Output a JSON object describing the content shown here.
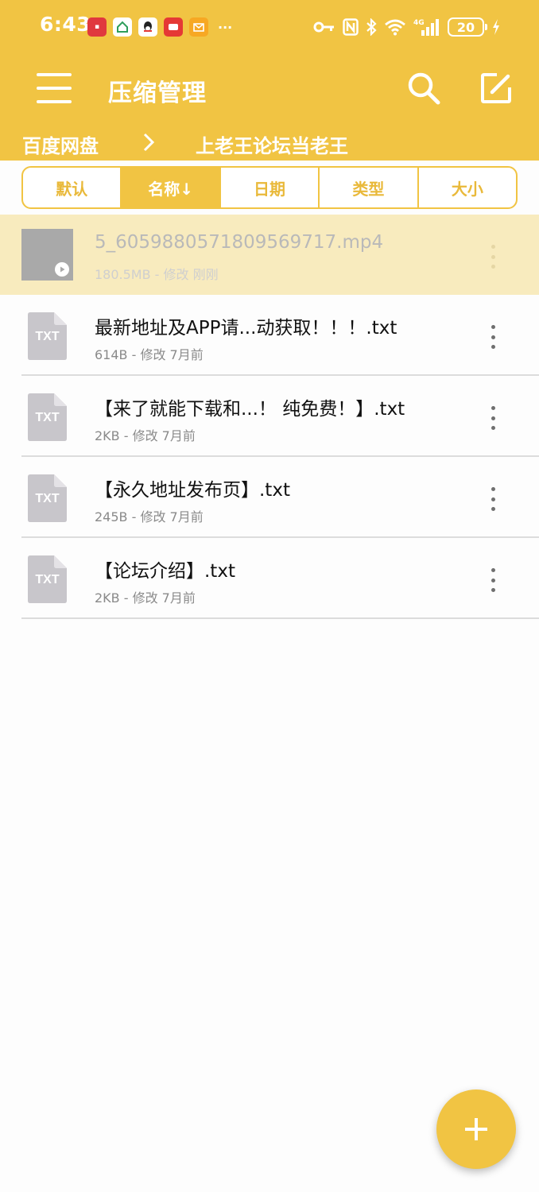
{
  "status_bar": {
    "time": "6:43",
    "network": "4G",
    "battery": "20",
    "more": "···",
    "notification_apps": [
      "huawei-app",
      "home-app",
      "qq-app",
      "news-app",
      "mail-app"
    ]
  },
  "toolbar": {
    "title": "压缩管理"
  },
  "breadcrumb": {
    "root": "百度网盘",
    "separator": ">",
    "current": "上老王论坛当老王"
  },
  "sort_tabs": [
    {
      "label": "默认",
      "active": false
    },
    {
      "label": "名称↓",
      "active": true
    },
    {
      "label": "日期",
      "active": false
    },
    {
      "label": "类型",
      "active": false
    },
    {
      "label": "大小",
      "active": false
    }
  ],
  "files": [
    {
      "name": "5_6059880571809569717.mp4",
      "meta": "180.5MB - 修改 刚刚",
      "type": "video",
      "selected": true
    },
    {
      "name": "最新地址及APP请...动获取！！！.txt",
      "meta": "614B - 修改 7月前",
      "type": "txt",
      "selected": false
    },
    {
      "name": "【来了就能下载和...！ 纯免费！】.txt",
      "meta": "2KB - 修改 7月前",
      "type": "txt",
      "selected": false
    },
    {
      "name": "【永久地址发布页】.txt",
      "meta": "245B - 修改 7月前",
      "type": "txt",
      "selected": false
    },
    {
      "name": "【论坛介绍】.txt",
      "meta": "2KB - 修改 7月前",
      "type": "txt",
      "selected": false
    }
  ],
  "file_icon_label": "TXT",
  "colors": {
    "accent": "#f1c443",
    "selected_row": "#f8ebbe",
    "icon_gray": "#c8c6cb"
  }
}
